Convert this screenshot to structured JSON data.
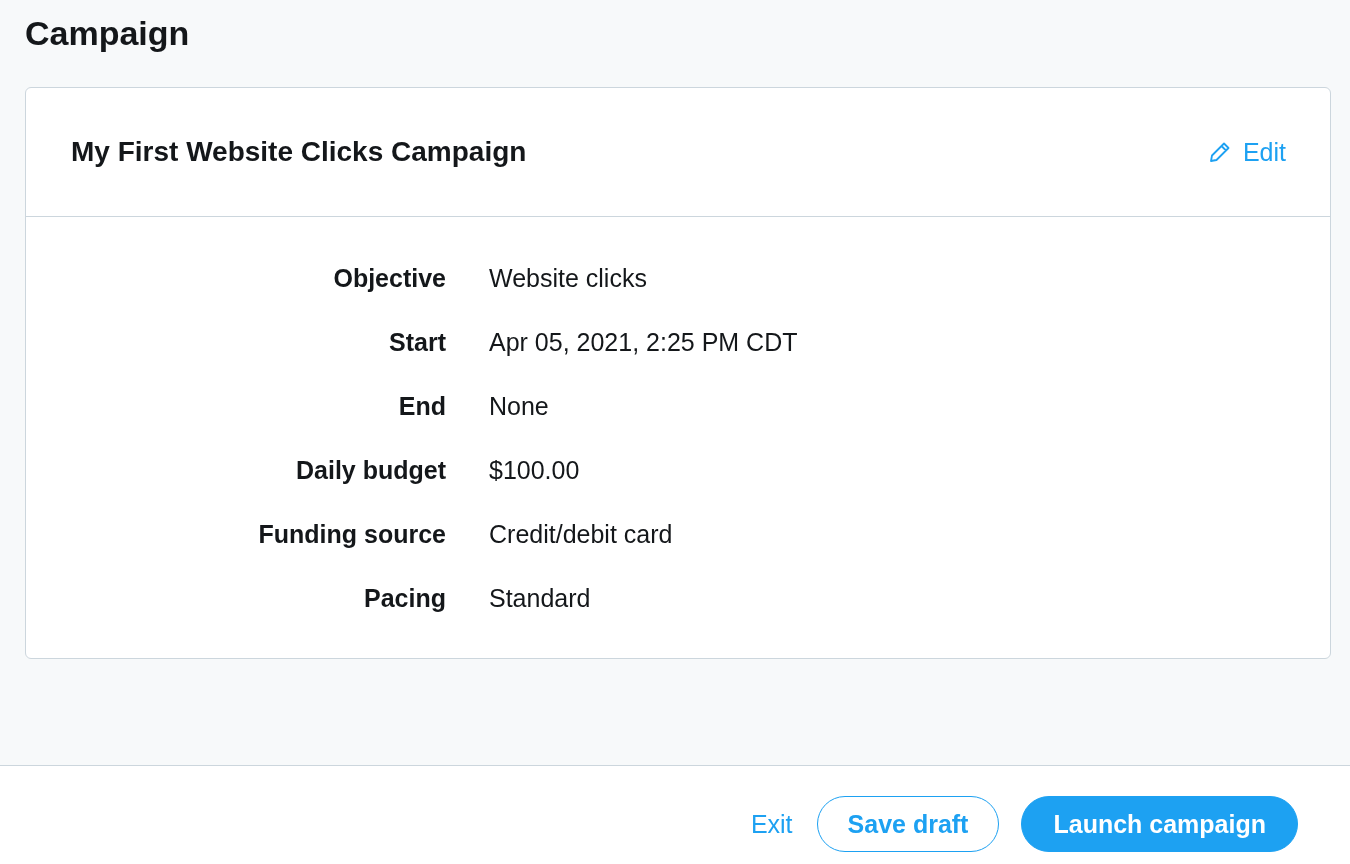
{
  "page": {
    "title": "Campaign"
  },
  "campaign_card": {
    "title": "My First Website Clicks Campaign",
    "edit_link": "Edit",
    "details": [
      {
        "label": "Objective",
        "value": "Website clicks"
      },
      {
        "label": "Start",
        "value": "Apr 05, 2021, 2:25 PM CDT"
      },
      {
        "label": "End",
        "value": "None"
      },
      {
        "label": "Daily budget",
        "value": "$100.00"
      },
      {
        "label": "Funding source",
        "value": "Credit/debit card"
      },
      {
        "label": "Pacing",
        "value": "Standard"
      }
    ]
  },
  "footer": {
    "buttons": [
      {
        "label": "Exit",
        "kind": "link"
      },
      {
        "label": "Save draft",
        "kind": "outline"
      },
      {
        "label": "Launch campaign",
        "kind": "primary"
      }
    ]
  }
}
